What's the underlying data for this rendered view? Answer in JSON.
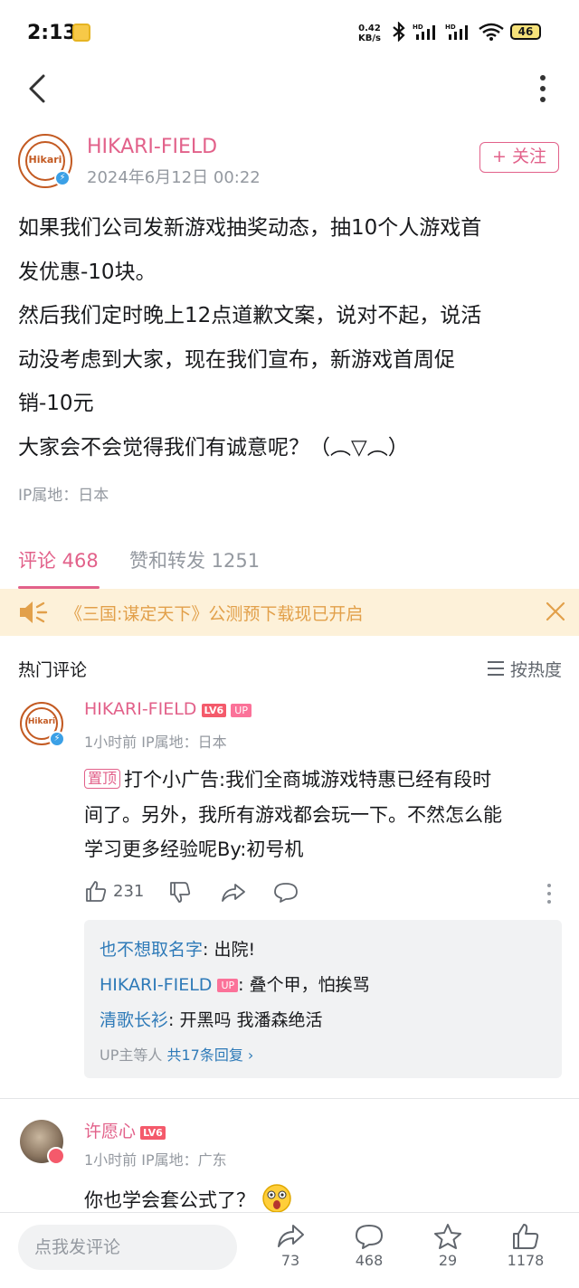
{
  "status_bar": {
    "time": "2:13",
    "net_speed_value": "0.42",
    "net_speed_unit": "KB/s",
    "battery": "46"
  },
  "post": {
    "author": "HIKARI-FIELD",
    "avatar_text": "Hikari",
    "date": "2024年6月12日 00:22",
    "follow_label": "+ 关注",
    "lines": [
      "如果我们公司发新游戏抽奖动态，抽10个人游戏首",
      "发优惠-10块。",
      "然后我们定时晚上12点道歉文案，说对不起，说活",
      "动没考虑到大家，现在我们宣布，新游戏首周促",
      "销-10元",
      "大家会不会觉得我们有诚意呢？（︵▽︵）"
    ],
    "ip": "IP属地：日本"
  },
  "tabs": {
    "comments": "评论 468",
    "reposts": "赞和转发 1251"
  },
  "notice": {
    "text": "《三国:谋定天下》公测预下载现已开启"
  },
  "comments_header": {
    "title": "热门评论",
    "sort": "按热度"
  },
  "comments": [
    {
      "name": "HIKARI-FIELD",
      "level": "LV6",
      "up_badge": "UP",
      "meta": "1小时前  IP属地：日本",
      "pin": "置顶",
      "lines": [
        "打个小广告:我们全商城游戏特惠已经有段时",
        "间了。另外，我所有游戏都会玩一下。不然怎么能",
        "学习更多经验呢By:初号机"
      ],
      "likes": "231",
      "replies": [
        {
          "name": "也不想取名字",
          "text": ": 出院!"
        },
        {
          "name": "HIKARI-FIELD",
          "badge": "UP",
          "text": ": 叠个甲，怕挨骂"
        },
        {
          "name": "清歌长衫",
          "text": ": 开黑吗 我潘森绝活"
        }
      ],
      "reply_summary_prefix": "UP主等人",
      "reply_summary_link": "共17条回复 ›"
    },
    {
      "name": "许愿心",
      "level": "LV6",
      "meta": "1小时前  IP属地：广东",
      "text": "你也学会套公式了？"
    }
  ],
  "bottom_bar": {
    "placeholder": "点我发评论",
    "share": "73",
    "comment": "468",
    "favorite": "29",
    "like": "1178"
  },
  "colors": {
    "accent_pink": "#e2618a",
    "link_blue": "#2e7ab8",
    "notice_bg": "#fdf1d9"
  }
}
